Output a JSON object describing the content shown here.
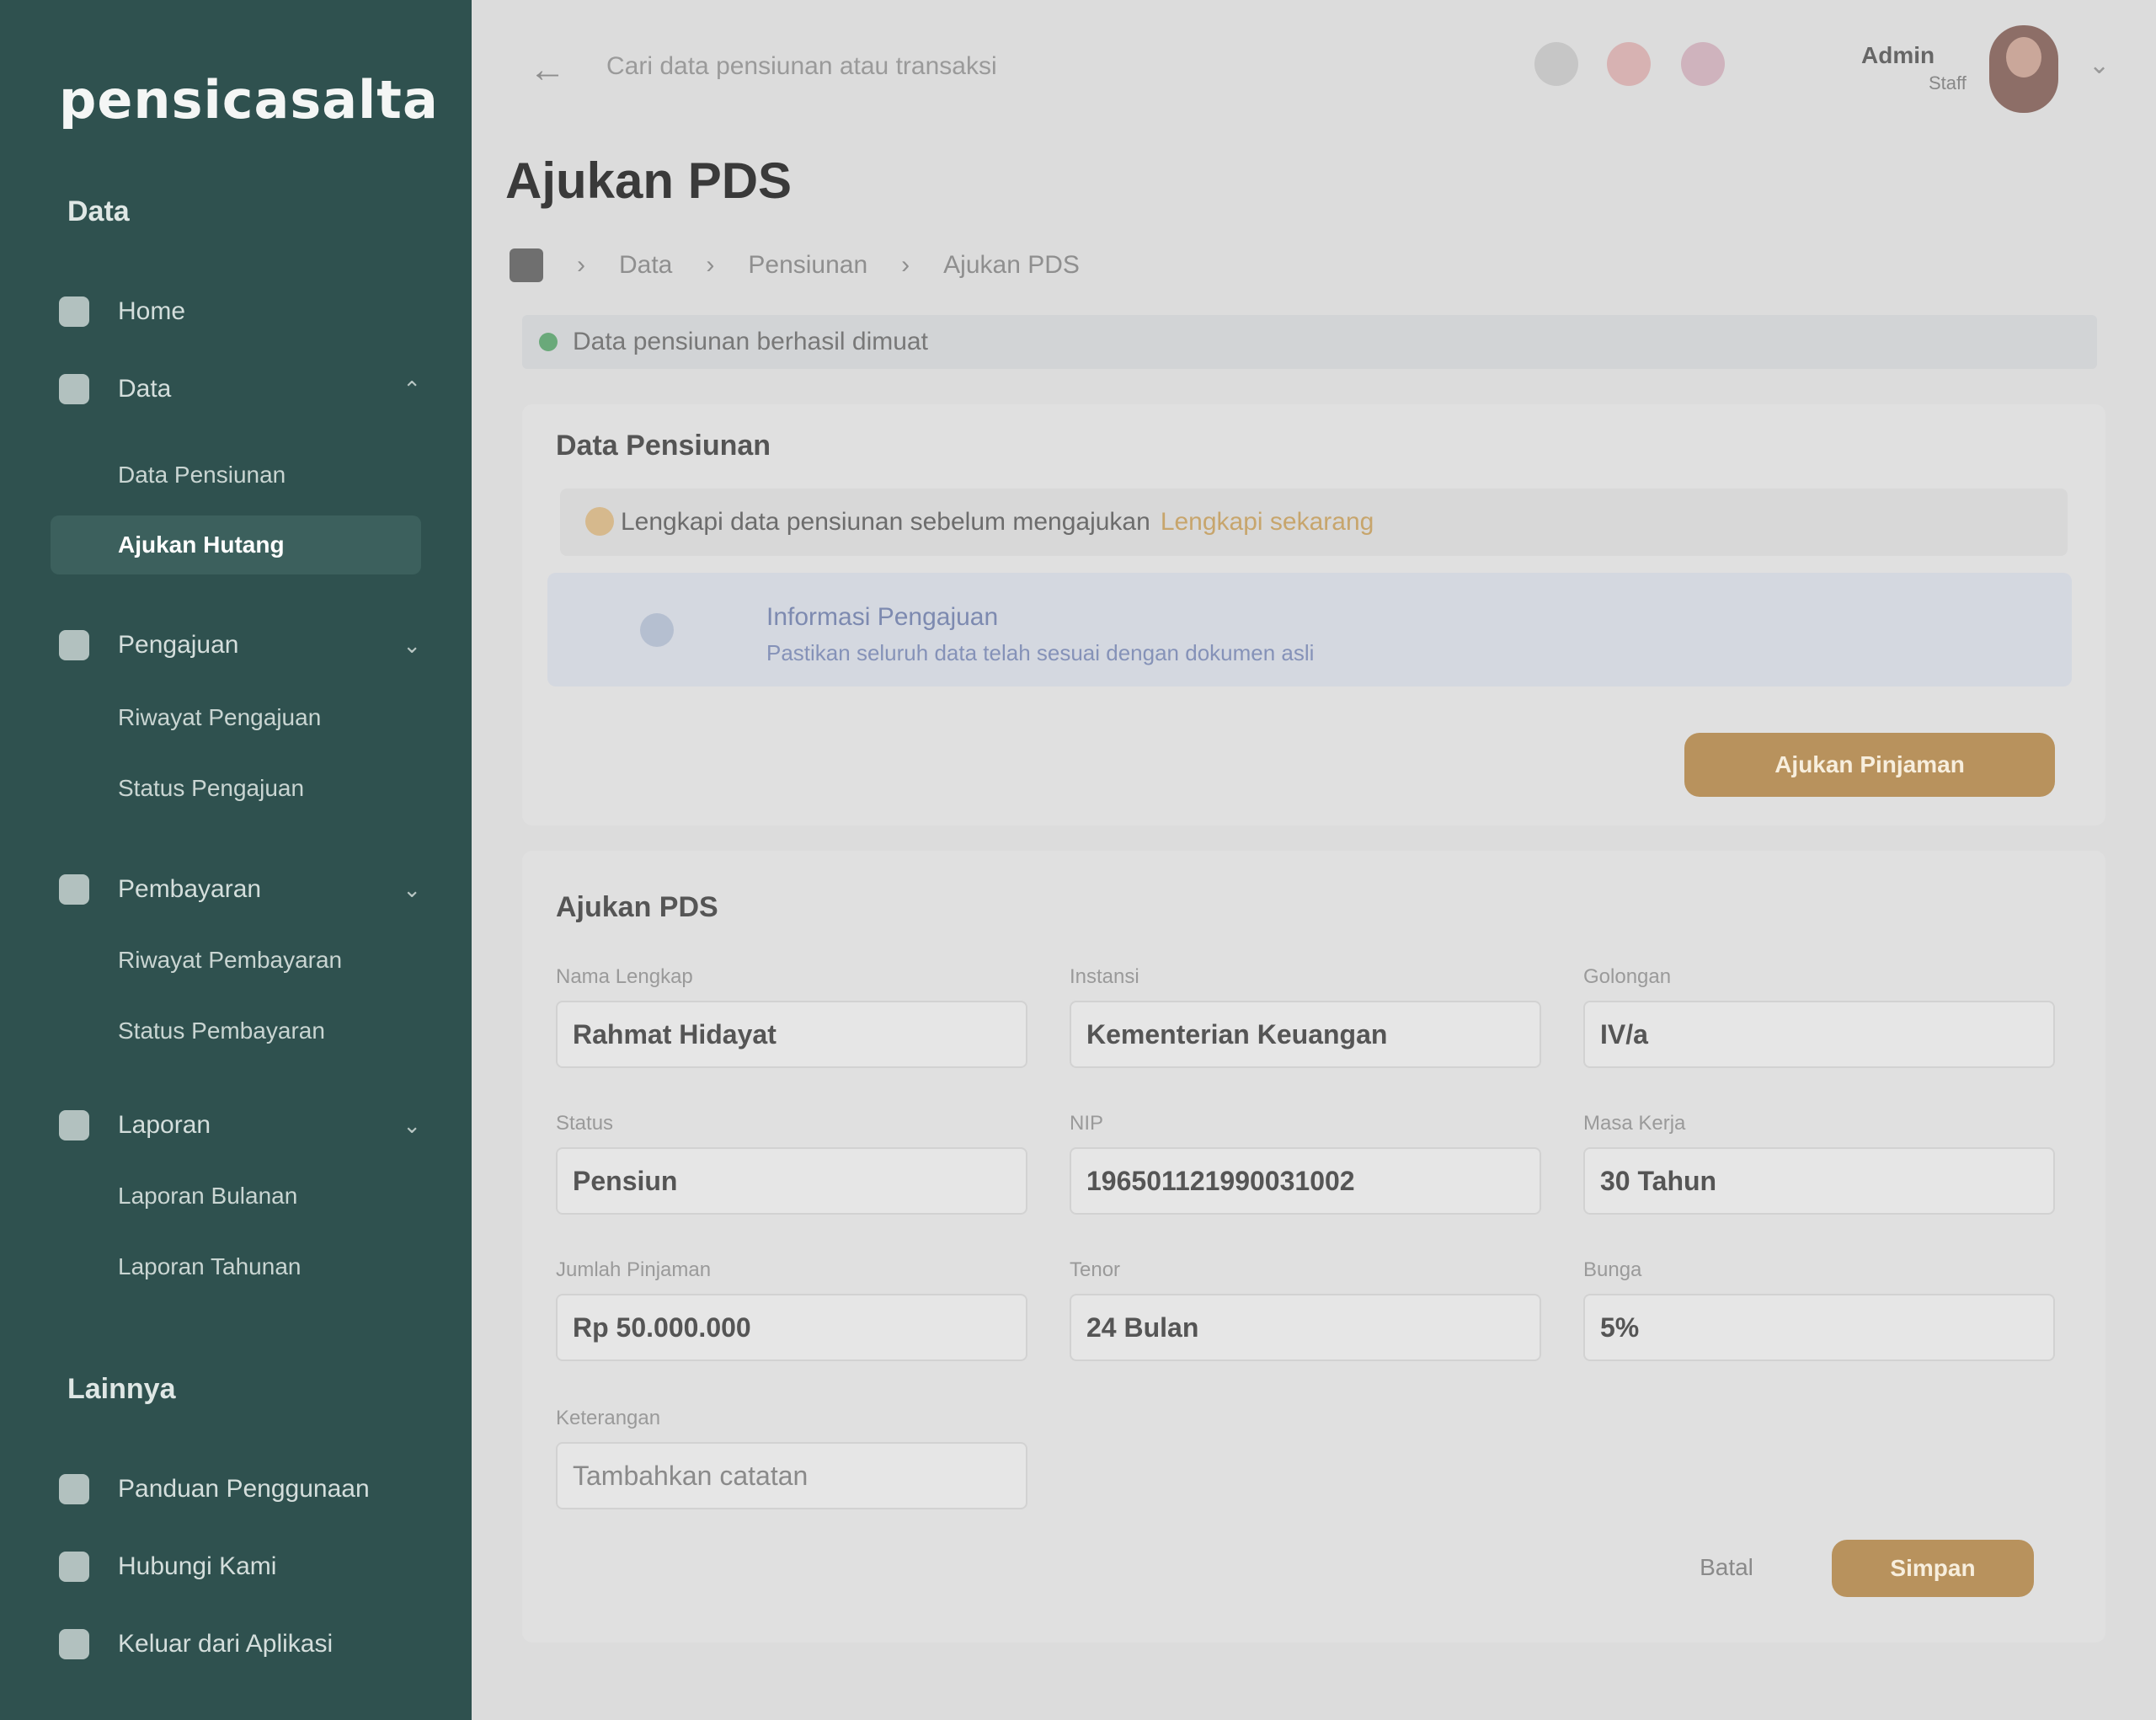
{
  "sidebar": {
    "logo": "pensicasalta",
    "section_main": "Data",
    "section_other": "Lainnya",
    "nav": [
      {
        "label": "Home"
      },
      {
        "label": "Data",
        "sub": [
          "Data Pensiunan",
          "Ajukan Hutang"
        ]
      },
      {
        "label": "Pengajuan",
        "sub": [
          "Riwayat Pengajuan",
          "Status Pengajuan"
        ]
      },
      {
        "label": "Pembayaran",
        "sub": [
          "Riwayat Pembayaran",
          "Status Pembayaran"
        ]
      },
      {
        "label": "Laporan",
        "sub": [
          "Laporan Bulanan",
          "Laporan Tahunan"
        ]
      }
    ],
    "other": [
      "Panduan Penggunaan",
      "Hubungi Kami",
      "Keluar dari Aplikasi"
    ]
  },
  "topbar": {
    "search_placeholder": "Cari data pensiunan atau transaksi",
    "user_name": "Admin",
    "user_role": "Staff",
    "icon_colors": [
      "#c6c6c6",
      "#d7b2b2",
      "#cfb3bd"
    ]
  },
  "header": {
    "title": "Ajukan PDS",
    "breadcrumb": [
      "Data",
      "Pensiunan",
      "Ajukan PDS"
    ],
    "alert": "Data pensiunan berhasil dimuat"
  },
  "card1": {
    "title": "Data Pensiunan",
    "warning_text": "Lengkapi data pensiunan sebelum mengajukan",
    "warning_link": "Lengkapi sekarang",
    "info_title": "Informasi Pengajuan",
    "info_text": "Pastikan seluruh data telah sesuai dengan dokumen asli",
    "button": "Ajukan Pinjaman"
  },
  "card2": {
    "title": "Ajukan PDS",
    "fields": [
      {
        "label": "Nama Lengkap",
        "value": "Rahmat Hidayat"
      },
      {
        "label": "Instansi",
        "value": "Kementerian Keuangan"
      },
      {
        "label": "Golongan",
        "value": "IV/a"
      },
      {
        "label": "Status",
        "value": "Pensiun"
      },
      {
        "label": "NIP",
        "value": "196501121990031002"
      },
      {
        "label": "Masa Kerja",
        "value": "30 Tahun"
      },
      {
        "label": "Jumlah Pinjaman",
        "value": "Rp 50.000.000"
      },
      {
        "label": "Tenor",
        "value": "24 Bulan"
      },
      {
        "label": "Bunga",
        "value": "5%"
      },
      {
        "label": "Keterangan",
        "value": "Tambahkan catatan"
      }
    ],
    "cancel": "Batal",
    "submit": "Simpan"
  }
}
